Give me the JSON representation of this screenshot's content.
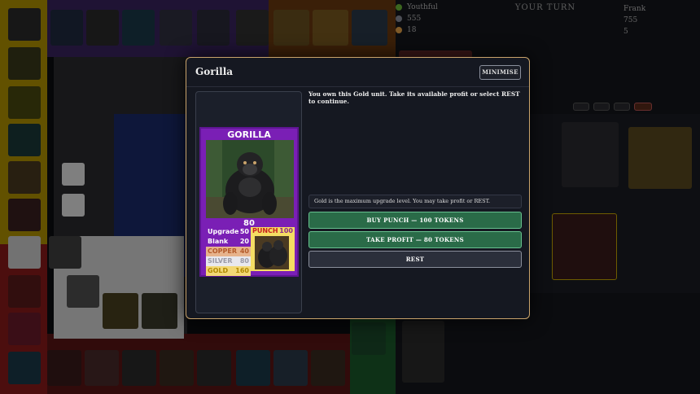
{
  "background": {
    "players_left": [
      {
        "name": "Youthful",
        "color": "#6dbb3a"
      },
      {
        "name": "555",
        "color": "#8a8f9c"
      },
      {
        "name": "18",
        "color": "#e8a44a"
      }
    ],
    "players_right": [
      {
        "name": "Frank",
        "color": "#e8763a"
      },
      {
        "name": "755",
        "color": "#8a8f9c"
      },
      {
        "name": "5",
        "color": "#e8c44a"
      }
    ],
    "turn_label": "YOUR TURN"
  },
  "modal": {
    "title": "Gorilla",
    "minimise_label": "MINIMISE",
    "message": "You own this Gold unit. Take its available profit or select REST to continue.",
    "notice": "Gold is the maximum upgrade level. You may take profit or REST.",
    "buttons": {
      "buy_punch": "BUY PUNCH — 100 TOKENS",
      "take_profit": "TAKE PROFIT — 80 TOKENS",
      "rest": "REST"
    }
  },
  "card": {
    "name": "GORILLA",
    "value": "80",
    "color": "#7a1fb5",
    "stats": [
      {
        "label": "Upgrade",
        "value": "50",
        "tier": "upgrade"
      },
      {
        "label": "Blank",
        "value": "20",
        "tier": "blank"
      },
      {
        "label": "COPPER",
        "value": "40",
        "tier": "copper"
      },
      {
        "label": "SILVER",
        "value": "80",
        "tier": "silver"
      },
      {
        "label": "GOLD",
        "value": "160",
        "tier": "gold"
      }
    ],
    "punch": {
      "label": "PUNCH",
      "value": "100"
    }
  }
}
